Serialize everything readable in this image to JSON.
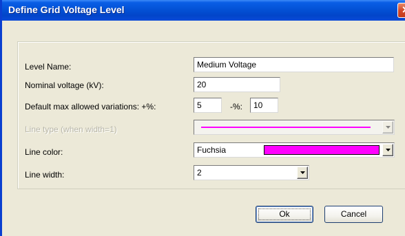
{
  "window": {
    "title": "Define Grid Voltage Level",
    "close_glyph": "✕"
  },
  "form": {
    "level_name_label": "Level Name:",
    "level_name_value": "Medium Voltage",
    "nominal_voltage_label": "Nominal voltage (kV):",
    "nominal_voltage_value": "20",
    "variations_label": "Default max allowed variations: +%:",
    "variation_plus_value": "5",
    "variation_minus_label": "-%:",
    "variation_minus_value": "10",
    "line_type_label": "Line type (when width=1)",
    "line_color_label": "Line color:",
    "line_color_value": "Fuchsia",
    "line_color_hex": "#ff00ff",
    "line_width_label": "Line width:",
    "line_width_value": "2"
  },
  "buttons": {
    "ok_label": "Ok",
    "cancel_label": "Cancel"
  },
  "icons": {
    "dropdown": "chevron-down-icon",
    "close": "close-icon"
  }
}
